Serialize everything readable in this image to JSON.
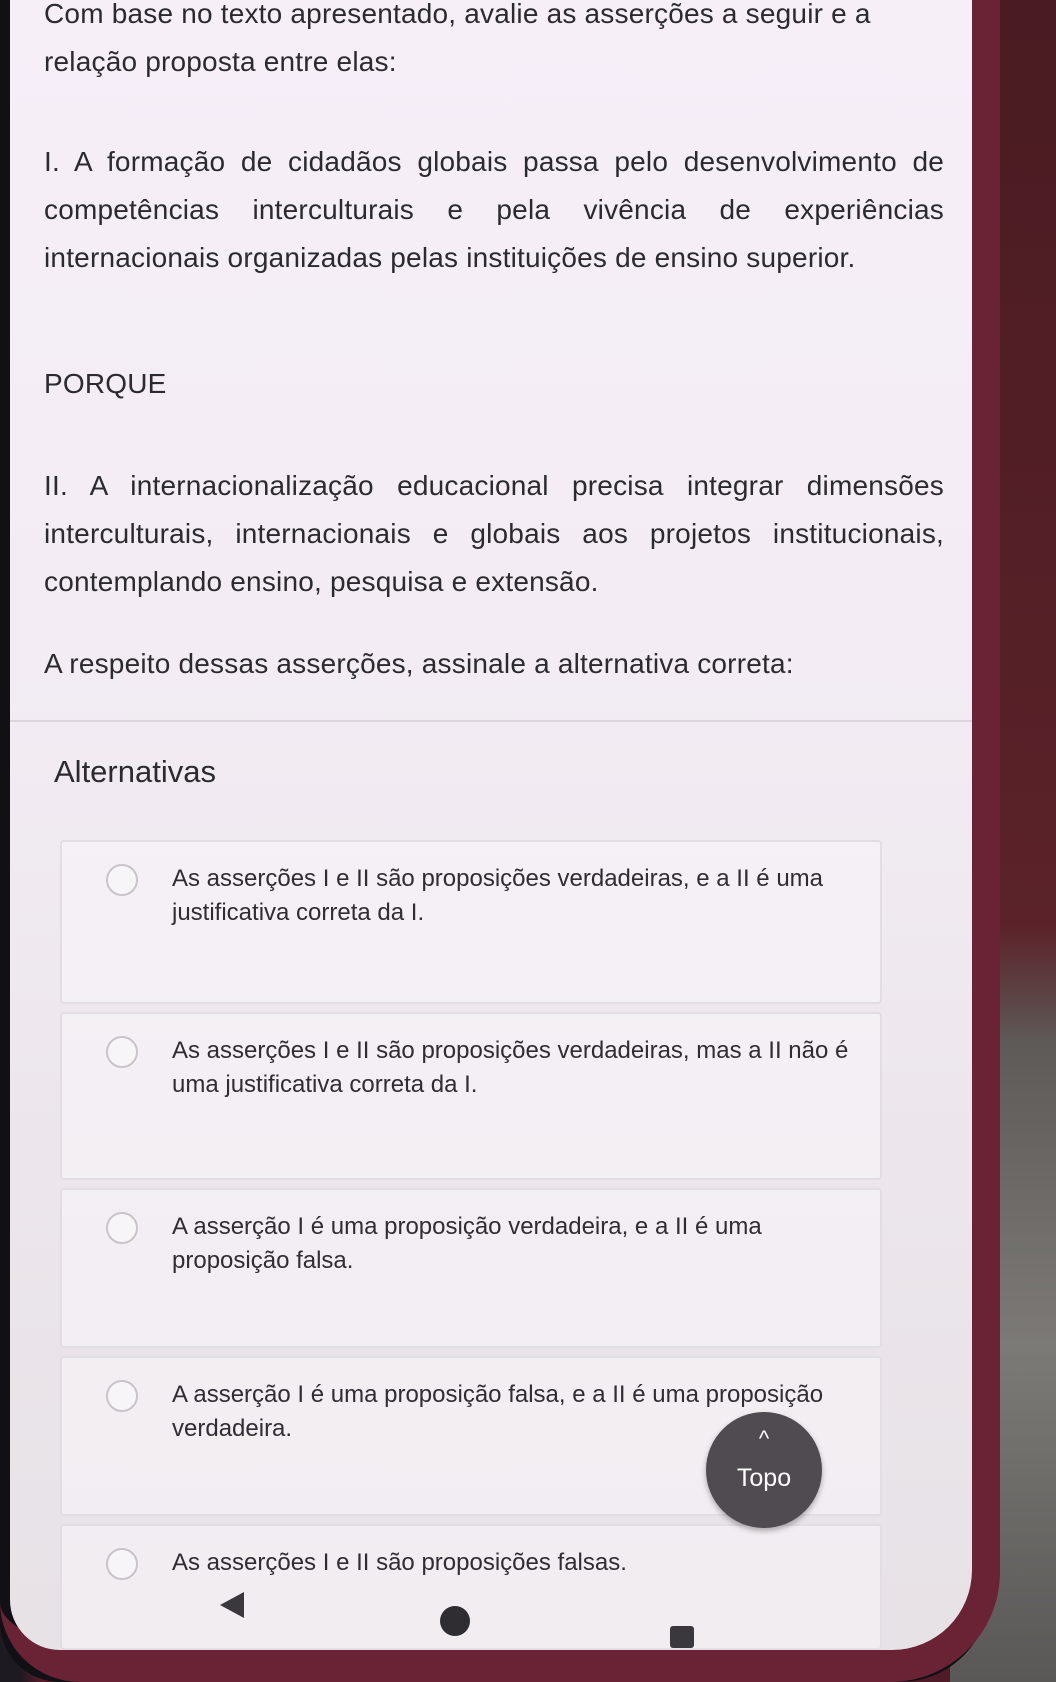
{
  "question": {
    "intro": "Com base no texto apresentado, avalie as asserções a seguir e a relação proposta entre elas:",
    "assertion_1": "I. A formação de cidadãos globais passa pelo desenvolvimento de competências interculturais e pela vivência de experiências internacionais organizadas pelas instituições de ensino superior.",
    "connector": "PORQUE",
    "assertion_2": "II. A internacionalização educacional precisa integrar dimensões interculturais, internacionais e globais aos projetos institucionais, contemplando ensino, pesquisa e extensão.",
    "prompt": "A respeito dessas asserções, assinale a alternativa correta:"
  },
  "alternatives": {
    "heading": "Alternativas",
    "options": [
      {
        "text": "As asserções I e II são proposições verdadeiras, e a II é uma justificativa correta da I."
      },
      {
        "text": "As asserções I e II são proposições verdadeiras, mas a II não é uma justificativa correta da I."
      },
      {
        "text": "A asserção I é uma proposição verdadeira, e a II é uma proposição falsa."
      },
      {
        "text": "A asserção I é uma proposição falsa, e a II é uma proposição verdadeira."
      },
      {
        "text": "As asserções I e II são proposições falsas."
      }
    ]
  },
  "topo_button": {
    "chevron": "^",
    "label": "Topo"
  },
  "navigation_bar": {
    "back_icon": "triangle-left",
    "home_icon": "circle",
    "recents_icon": "square"
  }
}
